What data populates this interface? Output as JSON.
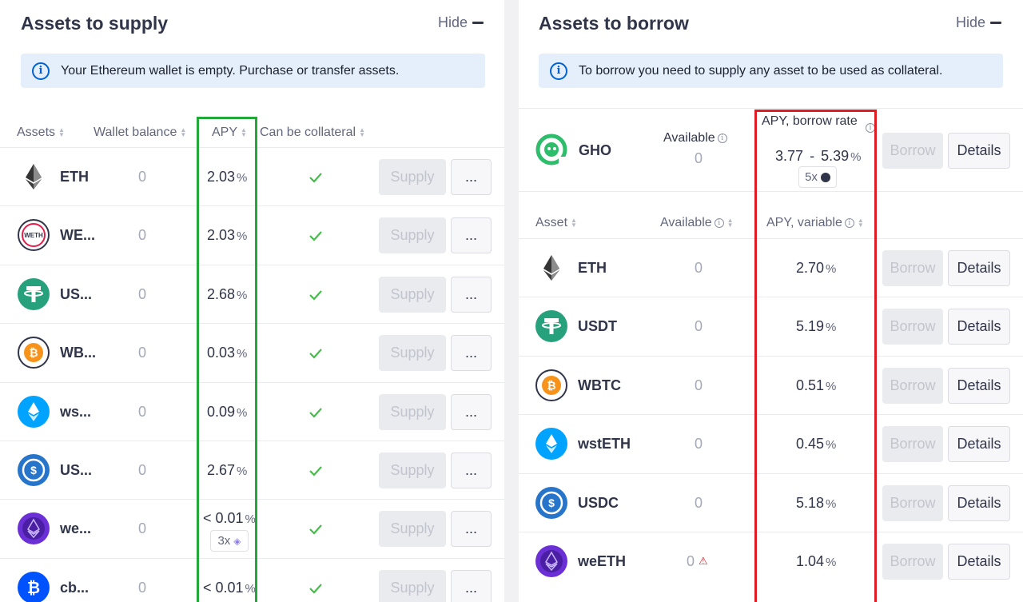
{
  "supply": {
    "title": "Assets to supply",
    "hide_label": "Hide",
    "alert": "Your Ethereum wallet is empty. Purchase or transfer assets.",
    "columns": [
      "Assets",
      "Wallet balance",
      "APY",
      "Can be collateral"
    ],
    "action_label": "Supply",
    "more_label": "...",
    "rows": [
      {
        "symbol": "ETH",
        "icon": "eth-icon",
        "balance": "0",
        "apy": "2.03",
        "collateral": true
      },
      {
        "symbol": "WE...",
        "icon": "weth-icon",
        "icon_text": "WETH",
        "balance": "0",
        "apy": "2.03",
        "collateral": true
      },
      {
        "symbol": "US...",
        "icon": "usdt-icon",
        "balance": "0",
        "apy": "2.68",
        "collateral": true
      },
      {
        "symbol": "WB...",
        "icon": "wbtc-icon",
        "balance": "0",
        "apy": "0.03",
        "collateral": true
      },
      {
        "symbol": "ws...",
        "icon": "wsteth-icon",
        "balance": "0",
        "apy": "0.09",
        "collateral": true
      },
      {
        "symbol": "US...",
        "icon": "usdc-icon",
        "balance": "0",
        "apy": "2.67",
        "collateral": true
      },
      {
        "symbol": "we...",
        "icon": "weeth-icon",
        "balance": "0",
        "apy": "< 0.01",
        "collateral": true,
        "boost": "3x"
      },
      {
        "symbol": "cb...",
        "icon": "cbbtc-icon",
        "balance": "0",
        "apy": "< 0.01",
        "collateral": true
      }
    ]
  },
  "borrow": {
    "title": "Assets to borrow",
    "hide_label": "Hide",
    "alert": "To borrow you need to supply any asset to be used as collateral.",
    "gho": {
      "symbol": "GHO",
      "available_label": "Available",
      "available": "0",
      "rate_label": "APY, borrow rate",
      "rate_min": "3.77",
      "rate_sep": "-",
      "rate_max": "5.39",
      "boost": "5x"
    },
    "columns": [
      "Asset",
      "Available",
      "APY, variable"
    ],
    "action_label": "Borrow",
    "details_label": "Details",
    "rows": [
      {
        "symbol": "ETH",
        "icon": "eth-icon",
        "available": "0",
        "apy": "2.70"
      },
      {
        "symbol": "USDT",
        "icon": "usdt-icon",
        "available": "0",
        "apy": "5.19"
      },
      {
        "symbol": "WBTC",
        "icon": "wbtc-icon",
        "available": "0",
        "apy": "0.51"
      },
      {
        "symbol": "wstETH",
        "icon": "wsteth-icon",
        "available": "0",
        "apy": "0.45"
      },
      {
        "symbol": "USDC",
        "icon": "usdc-icon",
        "available": "0",
        "apy": "5.18"
      },
      {
        "symbol": "weETH",
        "icon": "weeth-icon",
        "available": "0",
        "apy": "1.04",
        "warning": true
      }
    ]
  },
  "percent_sign": "%",
  "colors": {
    "supply_highlight": "#22a93a",
    "borrow_highlight": "#e01b24",
    "check": "#46bc4b",
    "alert_bg": "#e5effb"
  }
}
